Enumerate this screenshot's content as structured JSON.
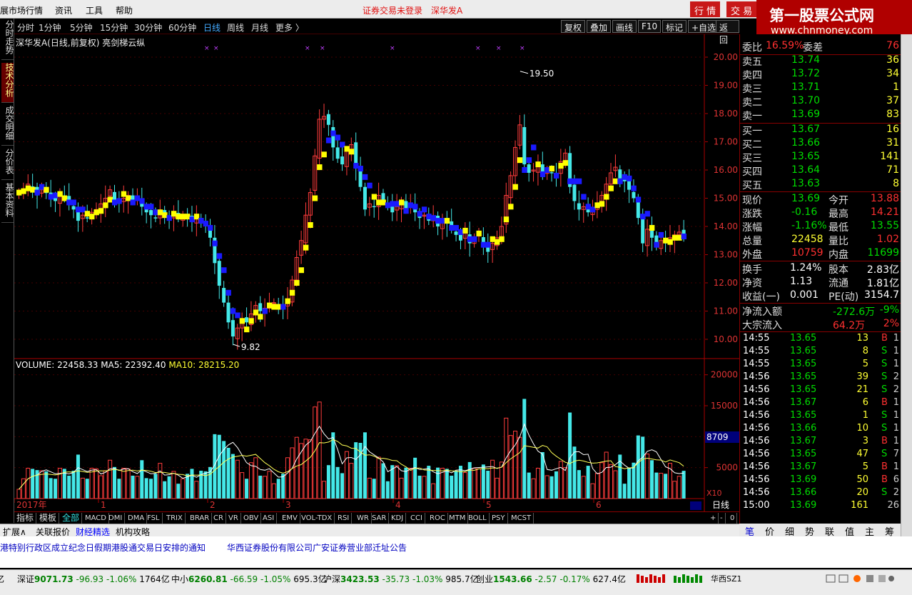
{
  "menubar": {
    "items": [
      "展市场行情",
      "资讯",
      "工具",
      "帮助"
    ],
    "status": "证券交易未登录",
    "stock": "深华发A",
    "btn_quote": "行 情",
    "btn_trade": "交 易"
  },
  "logo": {
    "line1": "第一股票公式网",
    "line2": "www.chnmoney.com"
  },
  "sidetabs": [
    "分时走势",
    "技术分析",
    "成交明细",
    "分价表",
    "基本资料"
  ],
  "periods": [
    "分时",
    "1分钟",
    "5分钟",
    "15分钟",
    "30分钟",
    "60分钟",
    "日线",
    "周线",
    "月线",
    "更多 〉"
  ],
  "active_period": "日线",
  "toolbuttons": [
    "复权",
    "叠加",
    "画线",
    "F10",
    "标记",
    "+自选",
    "返回"
  ],
  "chart_title": "深华发A(日线,前复权) 亮剑梯云纵",
  "chart_data": {
    "type": "candlestick",
    "ylim": [
      9.5,
      20.5
    ],
    "yticks": [
      "20.00",
      "19.00",
      "18.00",
      "17.00",
      "16.00",
      "15.00",
      "14.00",
      "13.00",
      "12.00",
      "11.00",
      "10.00"
    ],
    "high_label": "19.50",
    "low_label": "9.82",
    "x_labels": [
      "2017年",
      "1",
      "2",
      "3",
      "4",
      "5",
      "6"
    ],
    "volume_ticks": [
      "20000",
      "15000",
      "10000",
      "5000"
    ],
    "volume_unit": "X10",
    "volume_current": "8709",
    "period_label": "日线"
  },
  "volume_info": {
    "volume": "VOLUME: 22458.33",
    "ma5": "MA5: 22392.40",
    "ma10": "MA10: 28215.20"
  },
  "indicators": [
    "指标",
    "模板",
    "全部",
    "MACD",
    "DMI",
    "DMA",
    "FSL",
    "TRIX",
    "BRAR",
    "CR",
    "VR",
    "OBV",
    "ASI",
    "EMV",
    "VOL-TDX",
    "RSI",
    "WR",
    "SAR",
    "KDJ",
    "CCI",
    "ROC",
    "MTM",
    "BOLL",
    "PSY",
    "MCST"
  ],
  "bottom_tabs": [
    "扩展∧",
    "关联报价",
    "财经精选",
    "机构攻略"
  ],
  "news": [
    "香港特别行政区成立纪念日假期港股通交易日安排的通知",
    "华西证券股份有限公司广安证券营业部迁址公告"
  ],
  "statusbar": {
    "items": [
      {
        "name": "深证",
        "val": "9071.73",
        "chg": "-96.93",
        "pct": "-1.06%",
        "amt": "1764亿"
      },
      {
        "name": "中小",
        "val": "6260.81",
        "chg": "-66.59",
        "pct": "-1.05%",
        "amt": "695.3亿"
      },
      {
        "name": "沪深",
        "val": "3423.53",
        "chg": "-35.73",
        "pct": "-1.03%",
        "amt": "985.7亿"
      },
      {
        "name": "创业",
        "val": "1543.66",
        "chg": "-2.57",
        "pct": "-0.17%",
        "amt": "627.4亿"
      }
    ],
    "broker": "华西SZ1",
    "lead": "亿"
  },
  "quote": {
    "weibi": {
      "l1": "委比",
      "v1": "16.59%",
      "l2": "委差",
      "v2": "76"
    },
    "sell": [
      {
        "l": "卖五",
        "p": "13.74",
        "q": "36"
      },
      {
        "l": "卖四",
        "p": "13.72",
        "q": "34"
      },
      {
        "l": "卖三",
        "p": "13.71",
        "q": "1"
      },
      {
        "l": "卖二",
        "p": "13.70",
        "q": "37"
      },
      {
        "l": "卖一",
        "p": "13.69",
        "q": "83"
      }
    ],
    "buy": [
      {
        "l": "买一",
        "p": "13.67",
        "q": "16"
      },
      {
        "l": "买二",
        "p": "13.66",
        "q": "31"
      },
      {
        "l": "买三",
        "p": "13.65",
        "q": "141"
      },
      {
        "l": "买四",
        "p": "13.64",
        "q": "71"
      },
      {
        "l": "买五",
        "p": "13.63",
        "q": "8"
      }
    ],
    "stats": [
      {
        "l1": "现价",
        "v1": "13.69",
        "c1": "green",
        "l2": "今开",
        "v2": "13.88",
        "c2": "red"
      },
      {
        "l1": "涨跌",
        "v1": "-0.16",
        "c1": "green",
        "l2": "最高",
        "v2": "14.21",
        "c2": "red"
      },
      {
        "l1": "涨幅",
        "v1": "-1.16%",
        "c1": "green",
        "l2": "最低",
        "v2": "13.55",
        "c2": "green"
      },
      {
        "l1": "总量",
        "v1": "22458",
        "c1": "yellow",
        "l2": "量比",
        "v2": "1.02",
        "c2": "red"
      },
      {
        "l1": "外盘",
        "v1": "10759",
        "c1": "red",
        "l2": "内盘",
        "v2": "11699",
        "c2": "green"
      }
    ],
    "stats2": [
      {
        "l1": "换手",
        "v1": "1.24%",
        "l2": "股本",
        "v2": "2.83亿"
      },
      {
        "l1": "净资",
        "v1": "1.13",
        "l2": "流通",
        "v2": "1.81亿"
      },
      {
        "l1": "收益(一)",
        "v1": "0.001",
        "l2": "PE(动)",
        "v2": "3154.7"
      }
    ],
    "flow": [
      {
        "l": "净流入额",
        "v": "-272.6万",
        "p": "-9%",
        "c": "green"
      },
      {
        "l": "大宗流入",
        "v": "64.2万",
        "p": "2%",
        "c": "red"
      }
    ],
    "ticks": [
      {
        "t": "14:55",
        "p": "13.65",
        "q": "13",
        "d": "B",
        "n": "1"
      },
      {
        "t": "14:55",
        "p": "13.65",
        "q": "8",
        "d": "S",
        "n": "1"
      },
      {
        "t": "14:55",
        "p": "13.65",
        "q": "5",
        "d": "S",
        "n": "1"
      },
      {
        "t": "14:56",
        "p": "13.65",
        "q": "39",
        "d": "S",
        "n": "2"
      },
      {
        "t": "14:56",
        "p": "13.65",
        "q": "21",
        "d": "S",
        "n": "2"
      },
      {
        "t": "14:56",
        "p": "13.67",
        "q": "6",
        "d": "B",
        "n": "1"
      },
      {
        "t": "14:56",
        "p": "13.65",
        "q": "1",
        "d": "S",
        "n": "1"
      },
      {
        "t": "14:56",
        "p": "13.66",
        "q": "10",
        "d": "S",
        "n": "1"
      },
      {
        "t": "14:56",
        "p": "13.67",
        "q": "3",
        "d": "B",
        "n": "1"
      },
      {
        "t": "14:56",
        "p": "13.65",
        "q": "47",
        "d": "S",
        "n": "7"
      },
      {
        "t": "14:56",
        "p": "13.67",
        "q": "5",
        "d": "B",
        "n": "1"
      },
      {
        "t": "14:56",
        "p": "13.69",
        "q": "50",
        "d": "B",
        "n": "6"
      },
      {
        "t": "14:56",
        "p": "13.66",
        "q": "20",
        "d": "S",
        "n": "2"
      },
      {
        "t": "15:00",
        "p": "13.69",
        "q": "161",
        "d": "",
        "n": "26"
      }
    ],
    "tabs": [
      "笔",
      "价",
      "细",
      "势",
      "联",
      "值",
      "主",
      "筹"
    ]
  }
}
